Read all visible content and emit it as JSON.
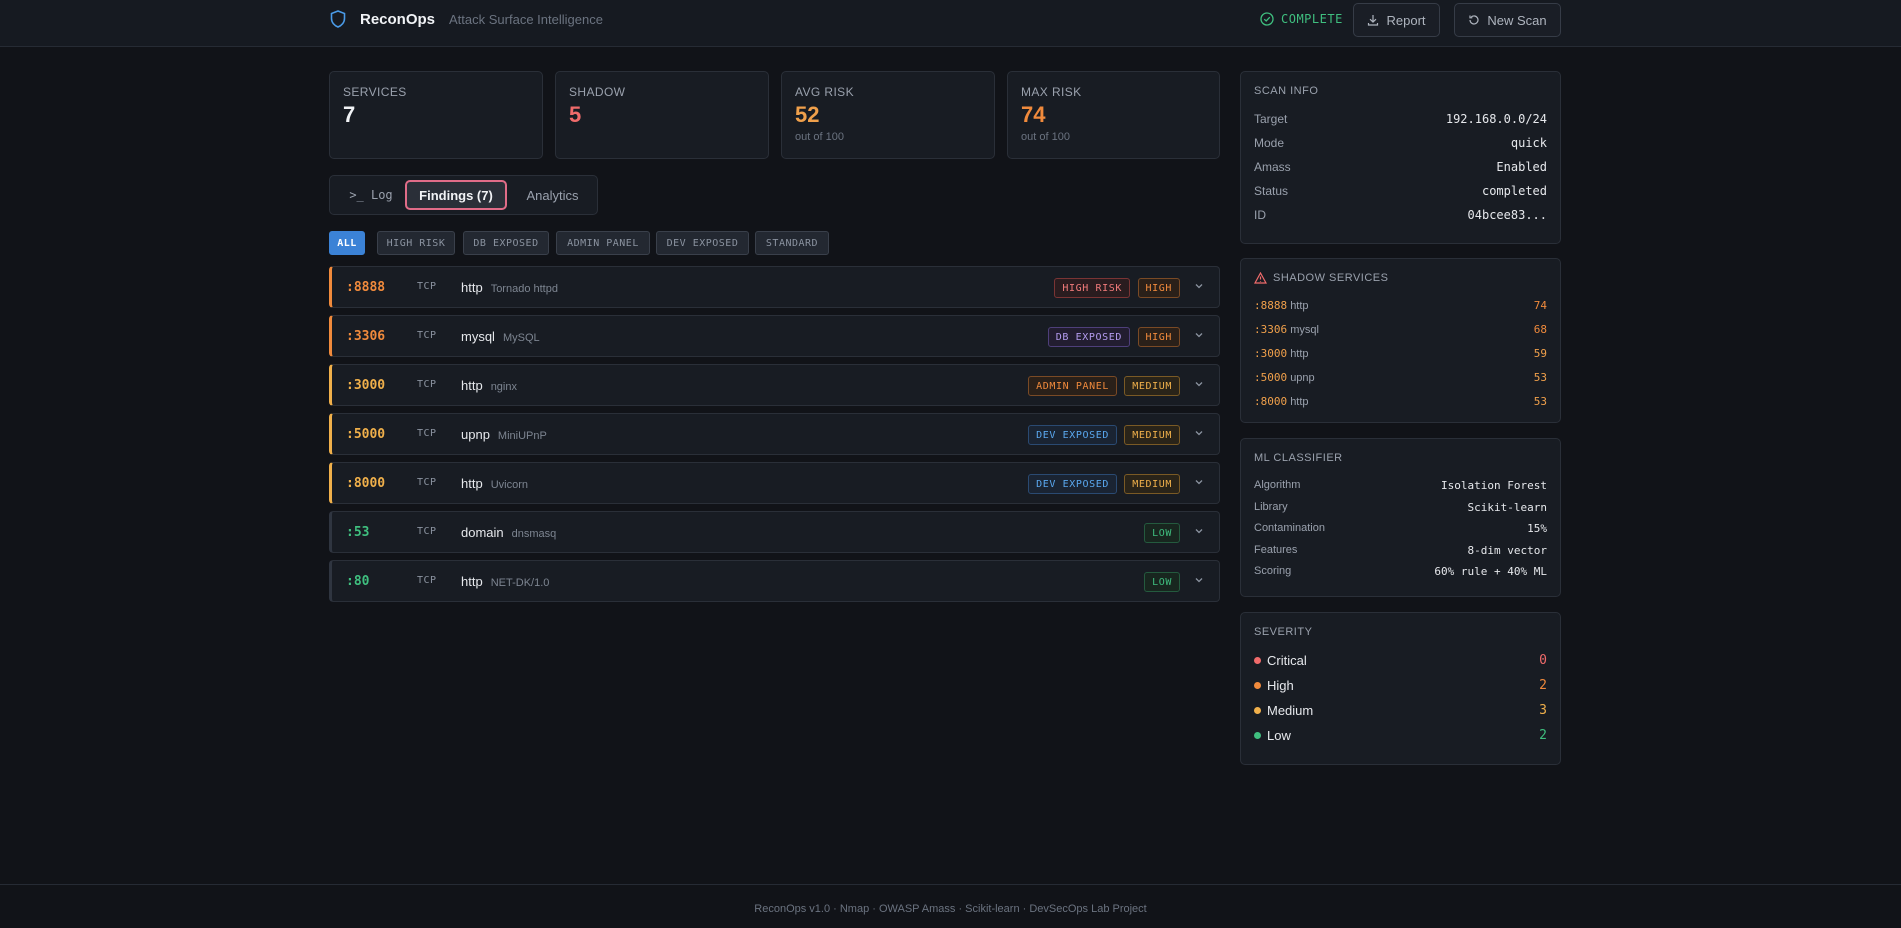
{
  "header": {
    "app_name": "ReconOps",
    "tagline": "Attack Surface Intelligence",
    "status": "COMPLETE",
    "report_label": "Report",
    "new_scan_label": "New Scan"
  },
  "stats": [
    {
      "label": "SERVICES",
      "value": "7",
      "sub": "",
      "color": "#f1f3f6"
    },
    {
      "label": "SHADOW",
      "value": "5",
      "sub": "",
      "color": "#f06b6b"
    },
    {
      "label": "AVG RISK",
      "value": "52",
      "sub": "out of 100",
      "color": "#f0a04b"
    },
    {
      "label": "MAX RISK",
      "value": "74",
      "sub": "out of 100",
      "color": "#f08a3c"
    }
  ],
  "tabs": {
    "log": ">_ Log",
    "findings": "Findings (7)",
    "analytics": "Analytics"
  },
  "filters": [
    "ALL",
    "HIGH RISK",
    "DB EXPOSED",
    "ADMIN PANEL",
    "DEV EXPOSED",
    "STANDARD"
  ],
  "findings": [
    {
      "port": ":8888",
      "proto": "TCP",
      "service": "http",
      "product": "Tornado httpd",
      "tag": "HIGH RISK",
      "severity": "HIGH"
    },
    {
      "port": ":3306",
      "proto": "TCP",
      "service": "mysql",
      "product": "MySQL",
      "tag": "DB EXPOSED",
      "severity": "HIGH"
    },
    {
      "port": ":3000",
      "proto": "TCP",
      "service": "http",
      "product": "nginx",
      "tag": "ADMIN PANEL",
      "severity": "MEDIUM"
    },
    {
      "port": ":5000",
      "proto": "TCP",
      "service": "upnp",
      "product": "MiniUPnP",
      "tag": "DEV EXPOSED",
      "severity": "MEDIUM"
    },
    {
      "port": ":8000",
      "proto": "TCP",
      "service": "http",
      "product": "Uvicorn",
      "tag": "DEV EXPOSED",
      "severity": "MEDIUM"
    },
    {
      "port": ":53",
      "proto": "TCP",
      "service": "domain",
      "product": "dnsmasq",
      "tag": "",
      "severity": "LOW"
    },
    {
      "port": ":80",
      "proto": "TCP",
      "service": "http",
      "product": "NET-DK/1.0",
      "tag": "",
      "severity": "LOW"
    }
  ],
  "scan_info": {
    "title": "SCAN INFO",
    "rows": [
      {
        "key": "Target",
        "value": "192.168.0.0/24"
      },
      {
        "key": "Mode",
        "value": "quick"
      },
      {
        "key": "Amass",
        "value": "Enabled"
      },
      {
        "key": "Status",
        "value": "completed"
      },
      {
        "key": "ID",
        "value": "04bcee83..."
      }
    ]
  },
  "shadow_services": {
    "title": "SHADOW SERVICES",
    "rows": [
      {
        "port": ":8888",
        "service": "http",
        "score": "74"
      },
      {
        "port": ":3306",
        "service": "mysql",
        "score": "68"
      },
      {
        "port": ":3000",
        "service": "http",
        "score": "59"
      },
      {
        "port": ":5000",
        "service": "upnp",
        "score": "53"
      },
      {
        "port": ":8000",
        "service": "http",
        "score": "53"
      }
    ]
  },
  "ml_classifier": {
    "title": "ML CLASSIFIER",
    "rows": [
      {
        "key": "Algorithm",
        "value": "Isolation Forest"
      },
      {
        "key": "Library",
        "value": "Scikit-learn"
      },
      {
        "key": "Contamination",
        "value": "15%"
      },
      {
        "key": "Features",
        "value": "8-dim vector"
      },
      {
        "key": "Scoring",
        "value": "60% rule + 40% ML"
      }
    ]
  },
  "severity": {
    "title": "SEVERITY",
    "rows": [
      {
        "label": "Critical",
        "count": "0",
        "color": "#f06b6b"
      },
      {
        "label": "High",
        "count": "2",
        "color": "#f08a3c"
      },
      {
        "label": "Medium",
        "count": "3",
        "color": "#f0b04b"
      },
      {
        "label": "Low",
        "count": "2",
        "color": "#3fbf7f"
      }
    ]
  },
  "footer": "ReconOps v1.0 · Nmap · OWASP Amass · Scikit-learn · DevSecOps Lab Project",
  "colors": {
    "accent": "#3b82d6",
    "high": "#f08a3c",
    "medium": "#f0b04b",
    "low": "#3fbf7f",
    "critical": "#f06b6b"
  }
}
